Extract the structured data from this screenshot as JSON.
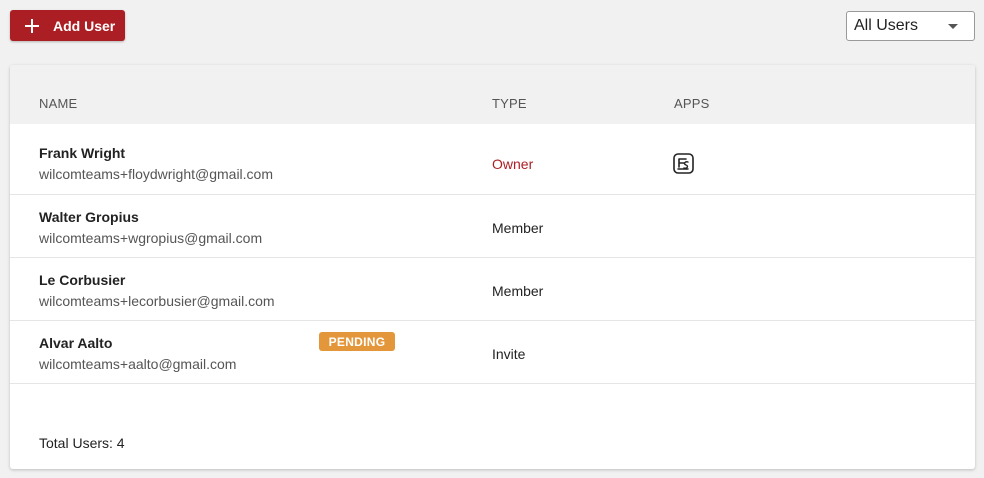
{
  "toolbar": {
    "add_user_label": "Add User",
    "filter_value": "All Users"
  },
  "table": {
    "headers": {
      "name": "NAME",
      "type": "TYPE",
      "apps": "APPS"
    },
    "rows": [
      {
        "name": "Frank Wright",
        "email": "wilcomteams+floydwright@gmail.com",
        "type": "Owner",
        "apps": [
          "app-icon"
        ]
      },
      {
        "name": "Walter Gropius",
        "email": "wilcomteams+wgropius@gmail.com",
        "type": "Member",
        "apps": []
      },
      {
        "name": "Le Corbusier",
        "email": "wilcomteams+lecorbusier@gmail.com",
        "type": "Member",
        "apps": []
      },
      {
        "name": "Alvar Aalto",
        "email": "wilcomteams+aalto@gmail.com",
        "type": "Invite",
        "badge": "PENDING",
        "apps": []
      }
    ],
    "total_label": "Total Users: 4"
  },
  "colors": {
    "accent": "#ab1f24",
    "pending_badge": "#e3973a",
    "background": "#f1f1f1"
  }
}
